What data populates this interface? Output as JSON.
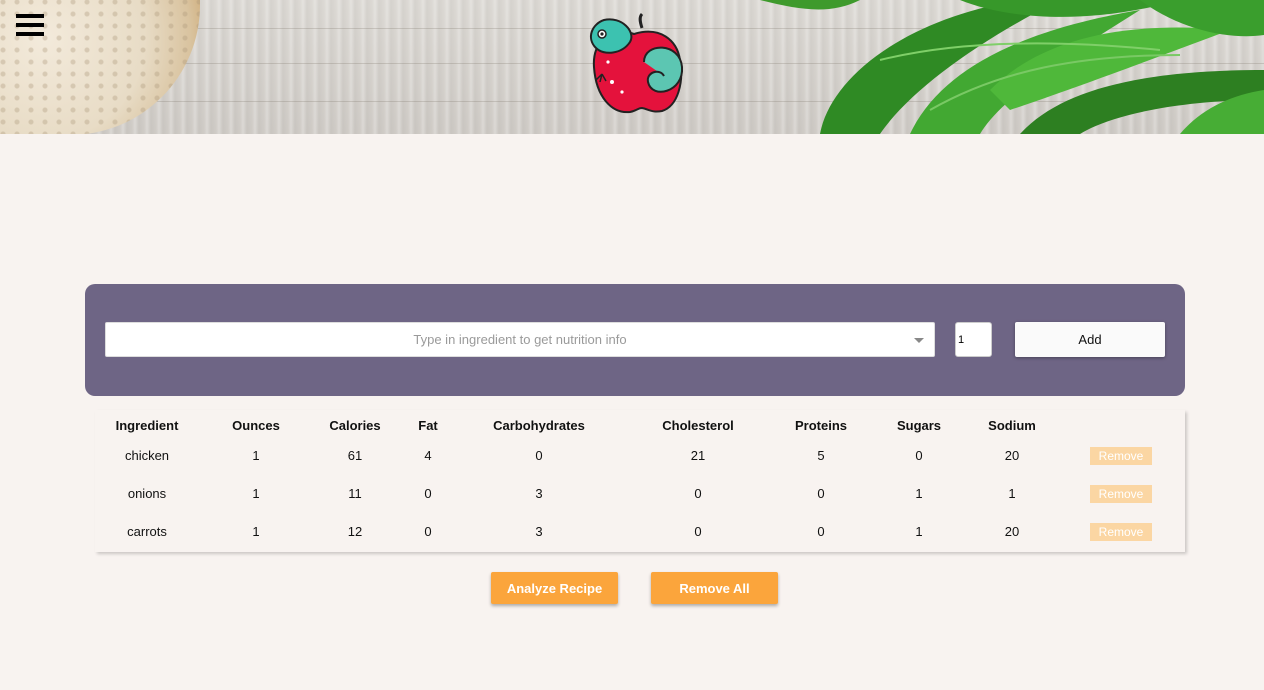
{
  "header": {
    "menu_icon": "hamburger-menu-icon",
    "logo_icon": "apple-chameleon-logo"
  },
  "ingredient_form": {
    "search_placeholder": "Type in ingredient to get nutrition info",
    "search_value": "",
    "quantity_value": "1",
    "add_label": "Add"
  },
  "table": {
    "columns": [
      "Ingredient",
      "Ounces",
      "Calories",
      "Fat",
      "Carbohydrates",
      "Cholesterol",
      "Proteins",
      "Sugars",
      "Sodium"
    ],
    "rows": [
      {
        "cells": [
          "chicken",
          "1",
          "61",
          "4",
          "0",
          "21",
          "5",
          "0",
          "20"
        ],
        "remove_label": "Remove"
      },
      {
        "cells": [
          "onions",
          "1",
          "11",
          "0",
          "3",
          "0",
          "0",
          "1",
          "1"
        ],
        "remove_label": "Remove"
      },
      {
        "cells": [
          "carrots",
          "1",
          "12",
          "0",
          "3",
          "0",
          "0",
          "1",
          "20"
        ],
        "remove_label": "Remove"
      }
    ]
  },
  "actions": {
    "analyze_label": "Analyze Recipe",
    "remove_all_label": "Remove All"
  },
  "colors": {
    "background": "#f8f3f0",
    "panel": "#6e6585",
    "accent_orange": "#fba53c",
    "remove_button": "#fbd6a3"
  }
}
